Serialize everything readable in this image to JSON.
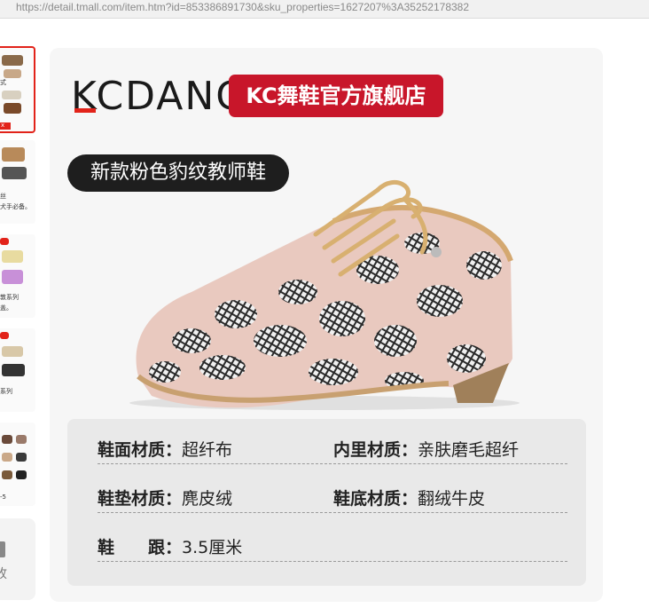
{
  "browser": {
    "url": "https://detail.tmall.com/item.htm?id=853386891730&sku_properties=1627207%3A35252178382"
  },
  "thumbnails": [
    {
      "caption_lines": [
        "式"
      ],
      "tag": "x"
    },
    {
      "caption_lines": [
        "丝",
        "犬手必备。"
      ]
    },
    {
      "caption_lines": [
        "敦系列",
        "盖。"
      ]
    },
    {
      "caption_lines": [
        "系列"
      ]
    },
    {
      "caption_lines": [
        "-5"
      ]
    }
  ],
  "more_button": {
    "label": "收"
  },
  "product": {
    "brand_logo": "KCDANCE",
    "shop_name": "KC舞鞋官方旗舰店",
    "title_badge": "新款粉色豹纹教师鞋",
    "specs": [
      {
        "key": "鞋面材质：",
        "value": "超纤布",
        "key2": "内里材质：",
        "value2": "亲肤磨毛超纤"
      },
      {
        "key": "鞋垫材质：",
        "value": "麂皮绒",
        "key2": "鞋底材质：",
        "value2": "翻绒牛皮"
      },
      {
        "key": "鞋　　跟：",
        "value": "3.5厘米"
      }
    ]
  },
  "colors": {
    "brand_red": "#c8162a",
    "spec_bg": "#e9e9e9",
    "shoe_pink": "#e9c9bf"
  }
}
